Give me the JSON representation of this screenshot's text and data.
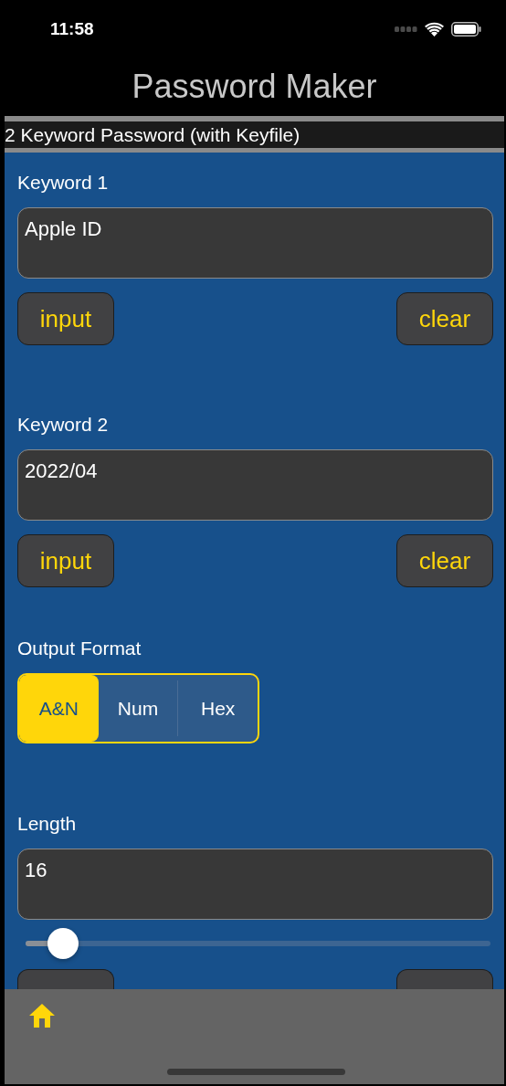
{
  "status_bar": {
    "time": "11:58"
  },
  "nav": {
    "title": "Password Maker"
  },
  "mode_banner": "2 Keyword Password (with Keyfile)",
  "keywords": [
    {
      "label": "Keyword 1",
      "value": "Apple ID",
      "buttons": [
        "input",
        "clear"
      ]
    },
    {
      "label": "Keyword 2",
      "value": "2022/04",
      "buttons": [
        "input",
        "clear"
      ]
    }
  ],
  "output_format": {
    "label": "Output Format",
    "options": [
      {
        "label": "A&N",
        "selected": true
      },
      {
        "label": "Num",
        "selected": false
      },
      {
        "label": "Hex",
        "selected": false
      }
    ]
  },
  "length": {
    "label": "Length",
    "value": "16",
    "level": 0.08
  }
}
